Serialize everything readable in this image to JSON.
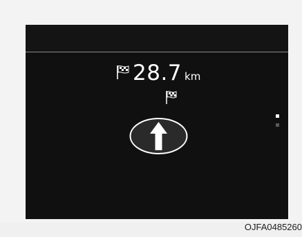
{
  "destination": {
    "icon": "checkered-flag-icon",
    "distance_value": "28.7",
    "distance_unit": "km"
  },
  "guidance": {
    "waypoint_icon": "checkered-flag-icon",
    "direction_icon": "straight-arrow-icon"
  },
  "page_indicator": {
    "total": 2,
    "active": 1
  },
  "caption": "OJFA0485260",
  "colors": {
    "screen_background": "#101010",
    "divider": "#8c8c8c",
    "text": "#ffffff",
    "inactive_dot": "#5a5a5a"
  }
}
